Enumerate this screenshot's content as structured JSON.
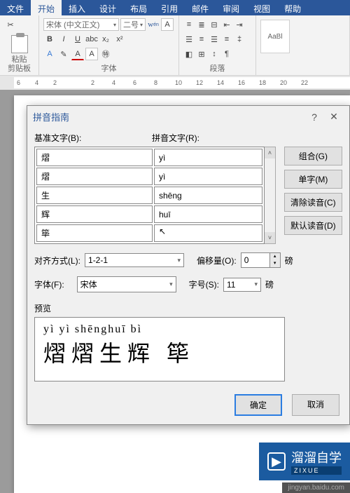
{
  "menubar": {
    "tabs": [
      "文件",
      "开始",
      "插入",
      "设计",
      "布局",
      "引用",
      "邮件",
      "审阅",
      "视图",
      "帮助"
    ],
    "active_index": 1
  },
  "ribbon": {
    "clipboard_label": "剪贴板",
    "paste_label": "粘贴",
    "font_group_label": "字体",
    "font_name": "宋体 (中文正文)",
    "font_size": "二号",
    "paragraph_label": "段落",
    "style_sample": "AaBl"
  },
  "ruler": {
    "marks": [
      "6",
      "4",
      "2",
      "",
      "2",
      "4",
      "6",
      "8",
      "10",
      "12",
      "14",
      "16",
      "18",
      "20",
      "22"
    ]
  },
  "dialog": {
    "title": "拼音指南",
    "help": "?",
    "close": "✕",
    "base_header": "基准文字(B):",
    "ruby_header": "拼音文字(R):",
    "rows": [
      {
        "base": "熠",
        "ruby": "yì"
      },
      {
        "base": "熠",
        "ruby": "yì"
      },
      {
        "base": "生",
        "ruby": "shēng"
      },
      {
        "base": "辉",
        "ruby": "huī"
      },
      {
        "base": "筚",
        "ruby": ""
      }
    ],
    "side": {
      "combine": "组合(G)",
      "single": "单字(M)",
      "clear": "清除读音(C)",
      "default": "默认读音(D)"
    },
    "align_label": "对齐方式(L):",
    "align_value": "1-2-1",
    "offset_label": "偏移量(O):",
    "offset_value": "0",
    "offset_unit": "磅",
    "font_label": "字体(F):",
    "font_value": "宋体",
    "size_label": "字号(S):",
    "size_value": "11",
    "size_unit": "磅",
    "preview_label": "预览",
    "preview_ruby": "yì yì shēnghuī  bì",
    "preview_hanzi": "熠熠生辉 筚",
    "ok": "确定",
    "cancel": "取消"
  },
  "watermark": {
    "brand": "溜溜自学",
    "sub": "ZIXUE"
  },
  "bottombar": "jingyan.baidu.com"
}
